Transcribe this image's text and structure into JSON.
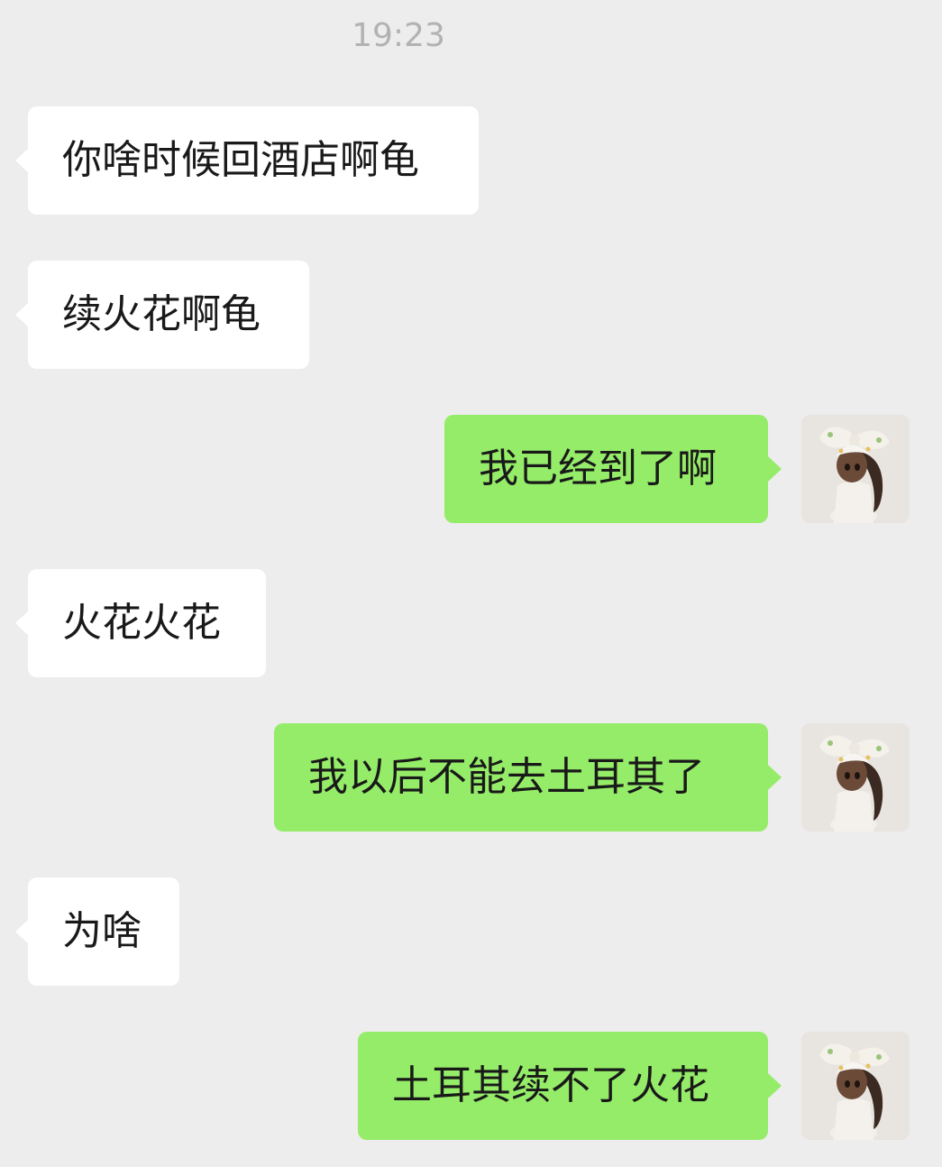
{
  "chat": {
    "timestamp": "19:23",
    "messages": [
      {
        "side": "incoming",
        "text": "你啥时候回酒店啊龟"
      },
      {
        "side": "incoming",
        "text": "续火花啊龟"
      },
      {
        "side": "outgoing",
        "text": "我已经到了啊",
        "avatar": "doll-avatar"
      },
      {
        "side": "incoming",
        "text": "火花火花"
      },
      {
        "side": "outgoing",
        "text": "我以后不能去土耳其了",
        "avatar": "doll-avatar"
      },
      {
        "side": "incoming",
        "text": "为啥"
      },
      {
        "side": "outgoing",
        "text": "土耳其续不了火花",
        "avatar": "doll-avatar"
      }
    ]
  },
  "colors": {
    "background": "#ededed",
    "incoming_bubble": "#ffffff",
    "outgoing_bubble": "#95ec69",
    "timestamp_text": "#b2b2b2",
    "message_text": "#191919"
  }
}
